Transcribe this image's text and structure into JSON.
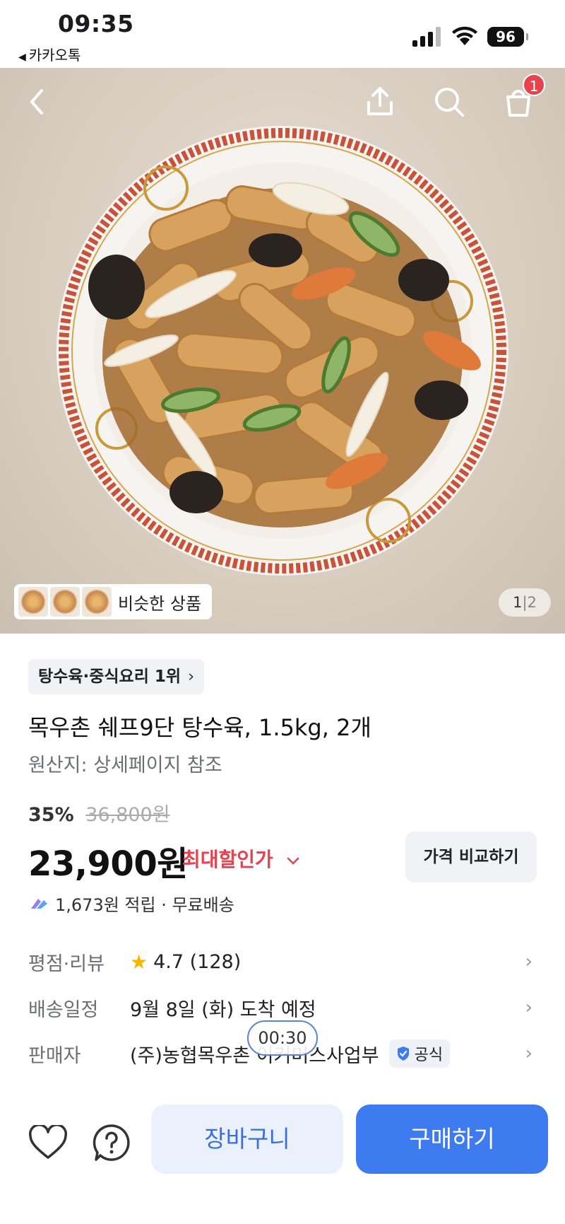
{
  "status_bar": {
    "time": "09:35",
    "back_app": "카카오톡",
    "battery": "96"
  },
  "hero": {
    "similar_label": "비슷한 상품",
    "page_current": "1",
    "page_sep": "|",
    "page_total": "2",
    "cart_badge": "1"
  },
  "product": {
    "rank_chip": "탕수육·중식요리 1위",
    "title": "목우촌 쉐프9단 탕수육, 1.5kg, 2개",
    "origin": "원산지: 상세페이지 참조",
    "discount_rate": "35%",
    "original_price": "36,800원",
    "price": "23,900원",
    "max_discount_label": "최대할인가",
    "compare_label": "가격 비교하기",
    "reward_text": "1,673원 적립 · 무료배송"
  },
  "info": {
    "rating_label": "평점·리뷰",
    "rating_value": "4.7 (128)",
    "delivery_label": "배송일정",
    "delivery_value": "9월 8일 (화) 도착 예정",
    "seller_label": "판매자",
    "seller_value": "(주)농협목우촌 이커머스사업부",
    "official_label": "공식"
  },
  "timer": "00:30",
  "bottom": {
    "cart_label": "장바구니",
    "buy_label": "구매하기"
  },
  "colors": {
    "accent": "#3e7bf0",
    "sale_red": "#e8424f",
    "star": "#f7b500"
  },
  "icons": [
    "back-arrow-icon",
    "share-icon",
    "search-icon",
    "cart-icon",
    "heart-icon",
    "help-icon",
    "reward-icon",
    "shield-check-icon"
  ]
}
